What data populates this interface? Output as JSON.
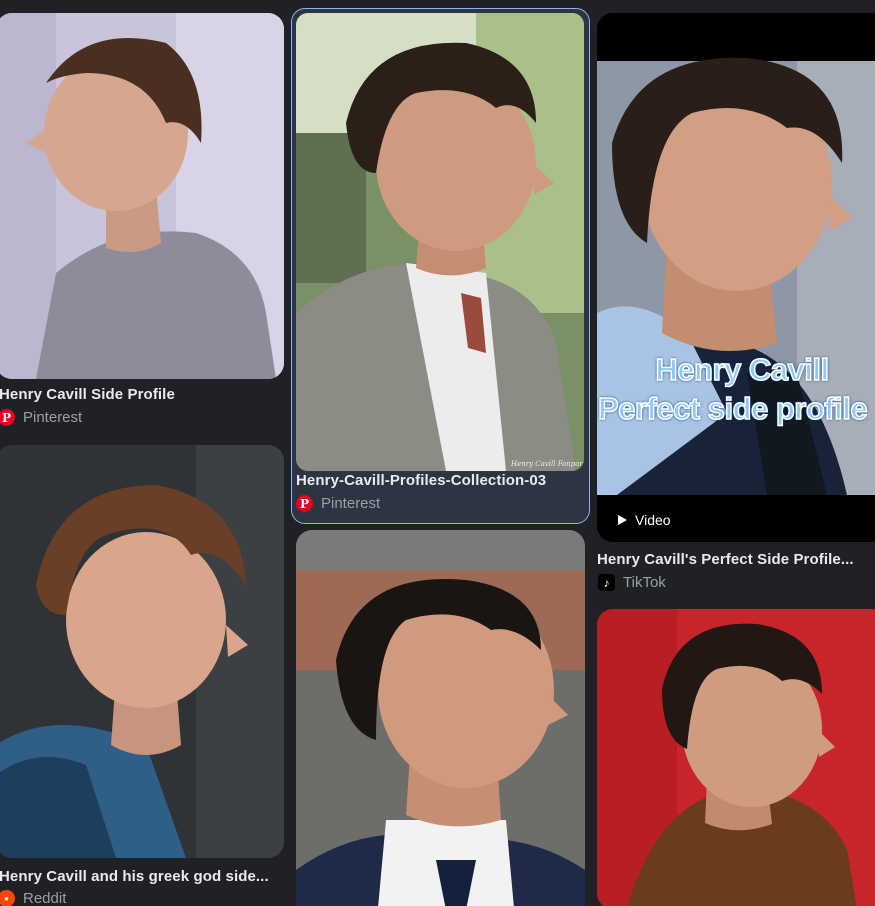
{
  "results": [
    {
      "title": "Henry Cavill Side Profile",
      "source": "Pinterest",
      "source_icon": "pinterest-icon"
    },
    {
      "title": "Henry Cavill and his greek god side...",
      "source": "Reddit",
      "source_icon": "reddit-icon"
    },
    {
      "title": "Henry-Cavill-Profiles-Collection-03",
      "source": "Pinterest",
      "source_icon": "pinterest-icon",
      "watermark": "Henry Cavill Fanpar",
      "selected": true
    },
    {
      "title": "",
      "source": "",
      "source_icon": ""
    },
    {
      "title": "Henry Cavill's Perfect Side Profile...",
      "source": "TikTok",
      "source_icon": "tiktok-icon",
      "overlay_line1": "Henry Cavill",
      "overlay_line2": "Perfect side profile",
      "badge": "Video"
    },
    {
      "title": "",
      "source": "",
      "source_icon": ""
    }
  ],
  "colors": {
    "background": "#202124",
    "title_text": "#e8eaed",
    "source_text": "#9aa0a6",
    "selection_border": "#8ab4f8",
    "pinterest": "#e60023",
    "reddit": "#ff4500"
  },
  "icons": {
    "pinterest": "P",
    "tiktok": "♪",
    "reddit": "●"
  }
}
